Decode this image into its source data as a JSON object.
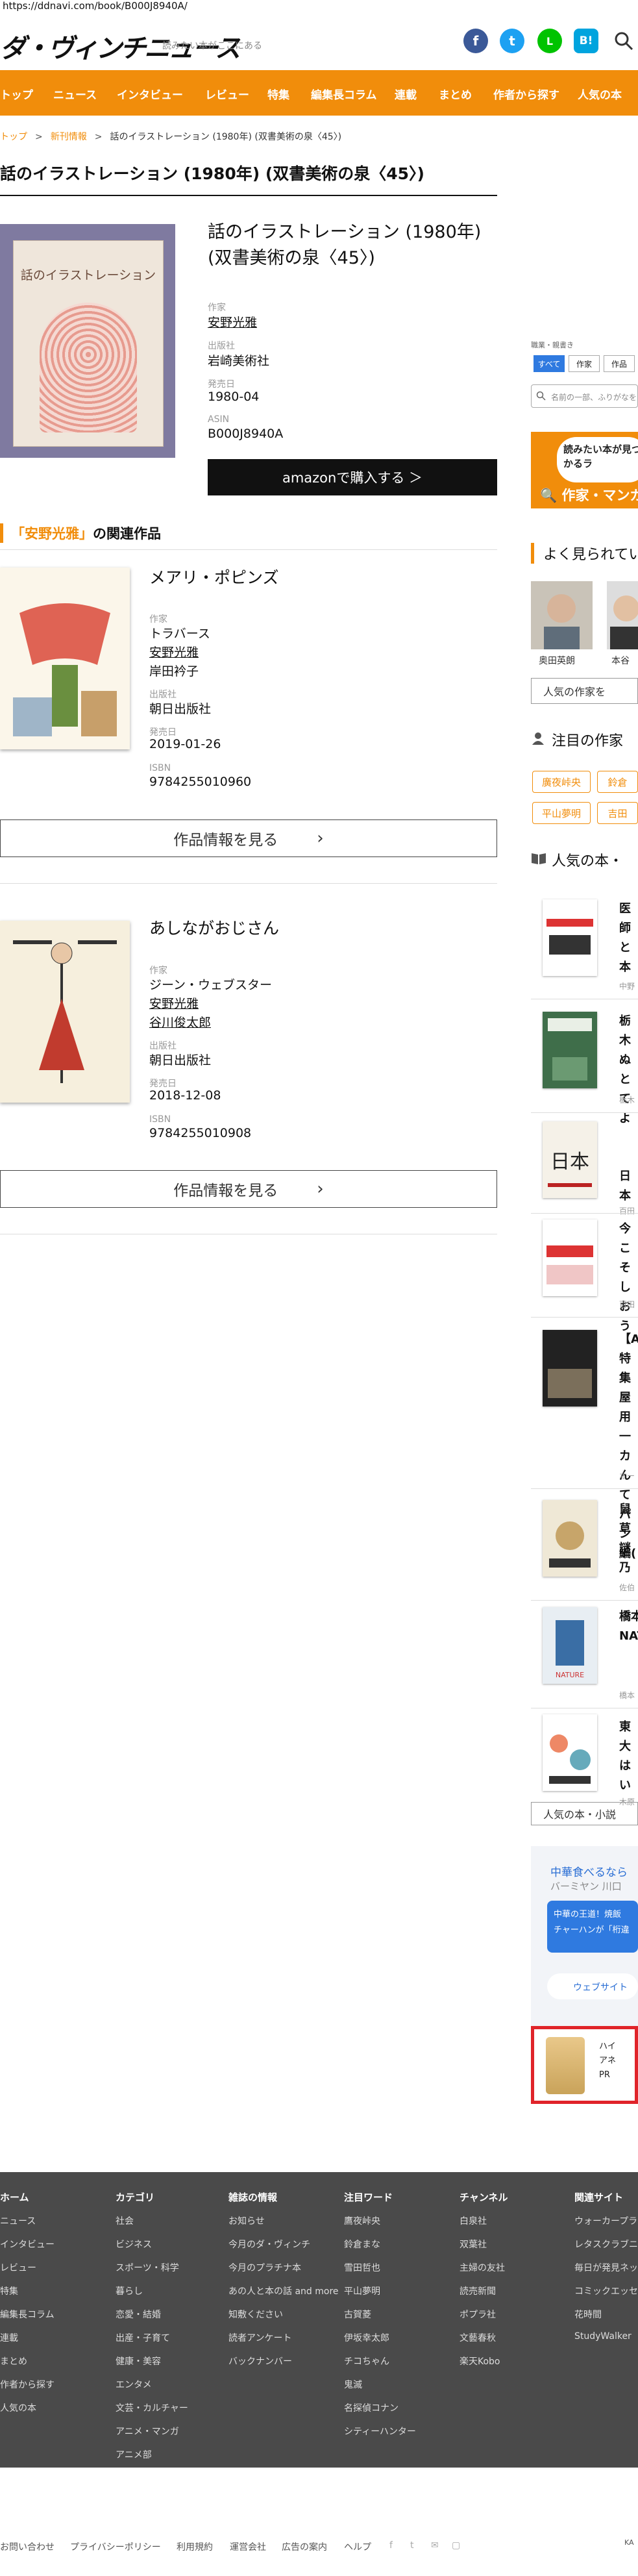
{
  "url": "https://ddnavi.com/book/B000J8940A/",
  "header": {
    "logo": "ダ・ヴィンチニュース",
    "tagline": "読みたい本がここにある"
  },
  "social": [
    {
      "name": "facebook",
      "glyph": "f",
      "color": "#3b5998"
    },
    {
      "name": "twitter",
      "glyph": "t",
      "color": "#1da1f2"
    },
    {
      "name": "line",
      "glyph": "L",
      "color": "#00c300"
    },
    {
      "name": "hatena",
      "glyph": "B!",
      "color": "#00a4de"
    }
  ],
  "nav": [
    "トップ",
    "ニュース",
    "インタビュー",
    "レビュー",
    "特集",
    "編集長コラム",
    "連載",
    "まとめ",
    "作者から探す",
    "人気の本"
  ],
  "breadcrumb": {
    "home": "トップ",
    "category": "新刊情報",
    "current": "話のイラストレーション (1980年) (双書美術の泉〈45〉)"
  },
  "page_title": "話のイラストレーション (1980年) (双書美術の泉〈45〉)",
  "book": {
    "cover_title": "話のイラストレーション",
    "title": "話のイラストレーション (1980年) (双書美術の泉〈45〉)",
    "author_label": "作家",
    "author": "安野光雅",
    "publisher_label": "出版社",
    "publisher": "岩崎美術社",
    "date_label": "発売日",
    "date": "1980-04",
    "asin_label": "ASIN",
    "asin": "B000J8940A",
    "amazon_label": "amazonで購入する ＞"
  },
  "related": {
    "heading_quote": "「安野光雅」",
    "heading_rest": "の関連作品",
    "more_label": "作品情報を見る",
    "items": [
      {
        "title": "メアリ・ポピンズ",
        "author_label": "作家",
        "authors": [
          "トラバース",
          "安野光雅",
          "岸田衿子"
        ],
        "publisher_label": "出版社",
        "publisher": "朝日出版社",
        "date_label": "発売日",
        "date": "2019-01-26",
        "isbn_label": "ISBN",
        "isbn": "9784255010960"
      },
      {
        "title": "あしながおじさん",
        "author_label": "作家",
        "authors": [
          "ジーン・ウェブスター",
          "安野光雅",
          "谷川俊太郎"
        ],
        "publisher_label": "出版社",
        "publisher": "朝日出版社",
        "date_label": "発売日",
        "date": "2018-12-08",
        "isbn_label": "ISBN",
        "isbn": "9784255010908"
      }
    ]
  },
  "sidebar": {
    "search_small": "職業・親書き",
    "tabs": [
      "すべて",
      "作家",
      "作品"
    ],
    "search_placeholder": "名前の一部、ふりがなを",
    "banner_bubble": "読みたい本が見つかるラ",
    "banner_label": "作家・マンガ",
    "popular_authors_heading": "よく見られてい",
    "authors": [
      "奥田英朗",
      "本谷"
    ],
    "popular_authors_btn": "人気の作家を",
    "attention_heading": "注目の作家",
    "chips": [
      "廣夜峠央",
      "鈴倉",
      "平山夢明",
      "吉田"
    ],
    "popular_books_heading": "人気の本・",
    "ranking": [
      {
        "title": "医師\nと\n本",
        "sub": "中野"
      },
      {
        "title": "栃木\nぬと\nてよ",
        "sub": "栃木"
      },
      {
        "title": "日本",
        "sub": "百田"
      },
      {
        "title": "今こ\nそし\nおう",
        "sub": "百田"
      },
      {
        "title": "【A\n特集\n屋用\n一カ\nんて\nパン\n編(",
        "sub": "オー"
      },
      {
        "title": "鼠草\n謎乃",
        "sub": "佐伯"
      },
      {
        "title": "橋本\nNAT",
        "sub": "橋本"
      },
      {
        "title": "東大\nはい",
        "sub": "木原"
      }
    ],
    "popular_books_btn": "人気の本・小説",
    "ad": {
      "heading": "中華食べるなら",
      "sub": "バーミヤン 川口",
      "box": "中華の王道！焼飯\nチャーハンが「桁違",
      "web": "ウェブサイト"
    },
    "ad2": "ハイ\nアネ\nPR"
  },
  "footer": {
    "columns": [
      {
        "heading": "ホーム",
        "items": [
          "ニュース",
          "インタビュー",
          "レビュー",
          "特集",
          "編集長コラム",
          "連載",
          "まとめ",
          "作者から探す",
          "人気の本"
        ]
      },
      {
        "heading": "カテゴリ",
        "items": [
          "社会",
          "ビジネス",
          "スポーツ・科学",
          "暮らし",
          "恋愛・結婚",
          "出産・子育て",
          "健康・美容",
          "エンタメ",
          "文芸・カルチャー",
          "アニメ・マンガ",
          "アニメ部"
        ]
      },
      {
        "heading": "雑誌の情報",
        "items": [
          "お知らせ",
          "今月のダ・ヴィンチ",
          "今月のプラチナ本",
          "あの人と本の話 and more",
          "知敷ください",
          "読者アンケート",
          "バックナンバー"
        ]
      },
      {
        "heading": "注目ワード",
        "items": [
          "鷹夜峠央",
          "鈴倉まな",
          "雪田哲也",
          "平山夢明",
          "古賀菱",
          "伊坂幸太郎",
          "チコちゃん",
          "鬼滅",
          "名探偵コナン",
          "シティーハンター"
        ]
      },
      {
        "heading": "チャンネル",
        "items": [
          "白泉社",
          "双葉社",
          "主婦の友社",
          "読売新聞",
          "ポプラ社",
          "文藝春秋",
          "楽天Kobo"
        ]
      },
      {
        "heading": "関連サイト",
        "items": [
          "ウォーカープラ",
          "レタスクラブニ",
          "毎日が発見ネッ",
          "コミックエッセ",
          "花時間",
          "StudyWalker"
        ]
      }
    ],
    "bottom_links": [
      "お問い合わせ",
      "プライバシーポリシー",
      "利用規約",
      "運営会社",
      "広告の案内",
      "ヘルプ"
    ],
    "bottom_icons": [
      "f",
      "t",
      "✉",
      "▢"
    ],
    "corner": "KA"
  }
}
